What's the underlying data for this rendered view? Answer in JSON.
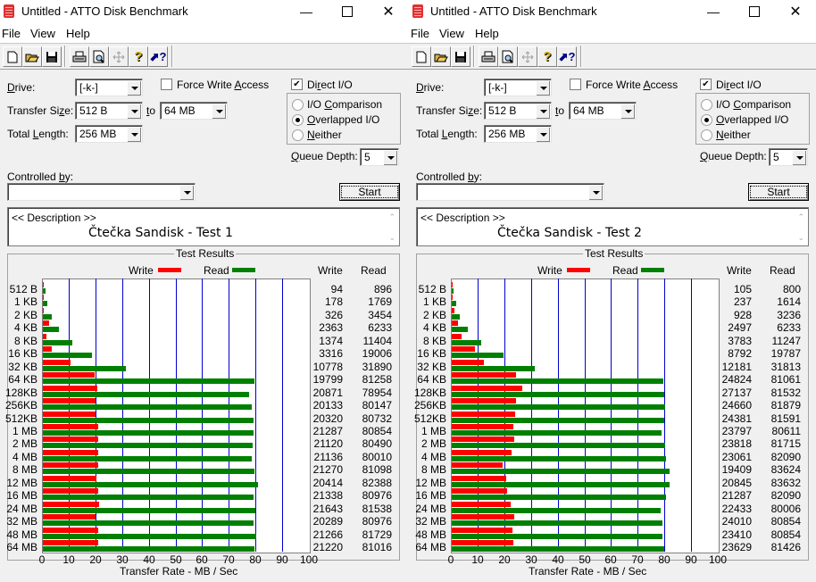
{
  "windows": [
    {
      "title": "Untitled - ATTO Disk Benchmark",
      "menu": [
        "File",
        "View",
        "Help"
      ],
      "toolbar": [
        "new-icon",
        "open-icon",
        "save-icon",
        "print-icon",
        "print-preview-icon",
        "move-icon",
        "help-icon",
        "context-help-icon"
      ],
      "drive_label": "Drive:",
      "drive": "[-k-]",
      "force_write_label": "Force Write Access",
      "force_write": false,
      "direct_io_label": "Direct I/O",
      "direct_io": true,
      "transfer_label": "Transfer Size:",
      "transfer_from": "512 B",
      "to_label": "to",
      "transfer_to": "64 MB",
      "total_length_label": "Total Length:",
      "total_length": "256 MB",
      "radio_options": [
        "I/O Comparison",
        "Overlapped I/O",
        "Neither"
      ],
      "radio_selected": 1,
      "queue_depth_label": "Queue Depth:",
      "queue_depth": "5",
      "controlled_by_label": "Controlled by:",
      "controlled_by": "",
      "start_label": "Start",
      "description_header": "<< Description >>",
      "description": "Čtečka Sandisk - Test 1",
      "results_title": "Test Results",
      "legend_write": "Write",
      "legend_read": "Read",
      "col_write": "Write",
      "col_read": "Read",
      "xlabel": "Transfer Rate - MB / Sec"
    },
    {
      "title": "Untitled - ATTO Disk Benchmark",
      "menu": [
        "File",
        "View",
        "Help"
      ],
      "toolbar": [
        "new-icon",
        "open-icon",
        "save-icon",
        "print-icon",
        "print-preview-icon",
        "move-icon",
        "help-icon",
        "context-help-icon"
      ],
      "drive_label": "Drive:",
      "drive": "[-k-]",
      "force_write_label": "Force Write Access",
      "force_write": false,
      "direct_io_label": "Direct I/O",
      "direct_io": true,
      "transfer_label": "Transfer Size:",
      "transfer_from": "512 B",
      "to_label": "to",
      "transfer_to": "64 MB",
      "total_length_label": "Total Length:",
      "total_length": "256 MB",
      "radio_options": [
        "I/O Comparison",
        "Overlapped I/O",
        "Neither"
      ],
      "radio_selected": 1,
      "queue_depth_label": "Queue Depth:",
      "queue_depth": "5",
      "controlled_by_label": "Controlled by:",
      "controlled_by": "",
      "start_label": "Start",
      "description_header": "<< Description >>",
      "description": "Čtečka Sandisk - Test 2",
      "results_title": "Test Results",
      "legend_write": "Write",
      "legend_read": "Read",
      "col_write": "Write",
      "col_read": "Read",
      "xlabel": "Transfer Rate - MB / Sec"
    }
  ],
  "colors": {
    "write": "#ff0000",
    "read": "#008000",
    "grid": "#0000d0"
  },
  "chart_data": [
    {
      "type": "bar",
      "title": "Test Results - Čtečka Sandisk - Test 1",
      "xlabel": "Transfer Rate - MB / Sec",
      "xlim": [
        0,
        100
      ],
      "xticks": [
        0,
        10,
        20,
        30,
        40,
        50,
        60,
        70,
        80,
        90,
        100
      ],
      "categories": [
        "512 B",
        "1 KB",
        "2 KB",
        "4 KB",
        "8 KB",
        "16 KB",
        "32 KB",
        "64 KB",
        "128KB",
        "256KB",
        "512KB",
        "1 MB",
        "2 MB",
        "4 MB",
        "8 MB",
        "12 MB",
        "16 MB",
        "24 MB",
        "32 MB",
        "48 MB",
        "64 MB"
      ],
      "series": [
        {
          "name": "Write",
          "unit": "KB/s",
          "values": [
            94,
            178,
            326,
            2363,
            1374,
            3316,
            10778,
            19799,
            20871,
            20133,
            20320,
            21287,
            21120,
            21136,
            21270,
            20414,
            21338,
            21643,
            20289,
            21266,
            21220
          ]
        },
        {
          "name": "Read",
          "unit": "KB/s",
          "values": [
            896,
            1769,
            3454,
            6233,
            11404,
            19006,
            31890,
            81258,
            78954,
            80147,
            80732,
            80854,
            80490,
            80010,
            81098,
            82388,
            80976,
            81538,
            80976,
            81729,
            81016
          ]
        }
      ],
      "legend": "top"
    },
    {
      "type": "bar",
      "title": "Test Results - Čtečka Sandisk - Test 2",
      "xlabel": "Transfer Rate - MB / Sec",
      "xlim": [
        0,
        100
      ],
      "xticks": [
        0,
        10,
        20,
        30,
        40,
        50,
        60,
        70,
        80,
        90,
        100
      ],
      "categories": [
        "512 B",
        "1 KB",
        "2 KB",
        "4 KB",
        "8 KB",
        "16 KB",
        "32 KB",
        "64 KB",
        "128KB",
        "256KB",
        "512KB",
        "1 MB",
        "2 MB",
        "4 MB",
        "8 MB",
        "12 MB",
        "16 MB",
        "24 MB",
        "32 MB",
        "48 MB",
        "64 MB"
      ],
      "series": [
        {
          "name": "Write",
          "unit": "KB/s",
          "values": [
            105,
            237,
            928,
            2497,
            3783,
            8792,
            12181,
            24824,
            27137,
            24660,
            24381,
            23797,
            23818,
            23061,
            19409,
            20845,
            21287,
            22433,
            24010,
            23410,
            23629
          ]
        },
        {
          "name": "Read",
          "unit": "KB/s",
          "values": [
            800,
            1614,
            3236,
            6233,
            11247,
            19787,
            31813,
            81061,
            81532,
            81879,
            81591,
            80611,
            81715,
            82090,
            83624,
            83632,
            82090,
            80006,
            80854,
            80854,
            81426
          ]
        }
      ],
      "legend": "top"
    }
  ]
}
